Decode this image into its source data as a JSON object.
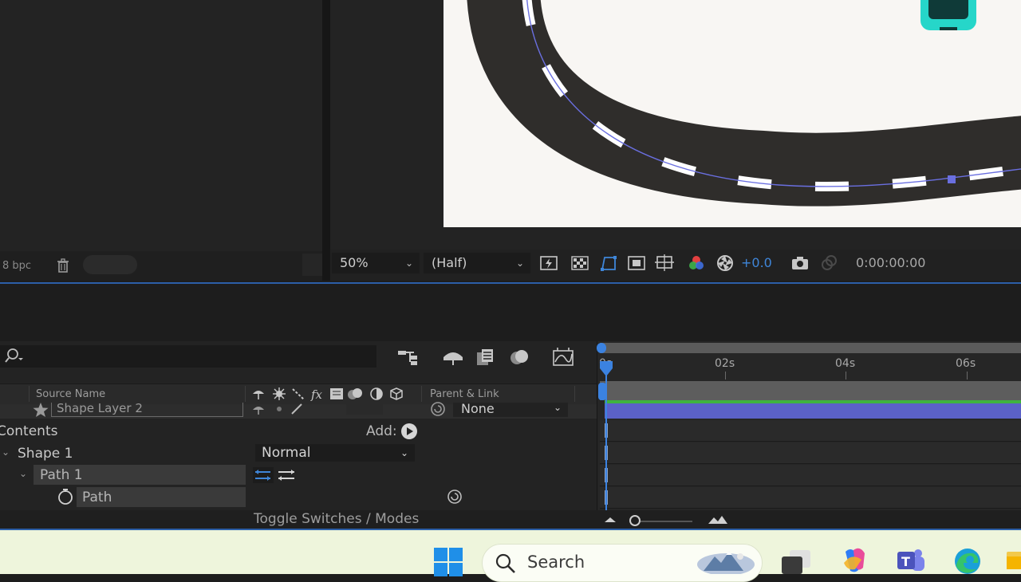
{
  "project_panel": {
    "bpc_label": "8 bpc",
    "delete_icon": "trash-icon"
  },
  "viewer": {
    "zoom": "50%",
    "resolution": "(Half)",
    "exposure": "+0.0",
    "timecode": "0:00:00:00",
    "icons": [
      "fast-preview-icon",
      "transparency-grid-icon",
      "mask-path-visibility-icon",
      "region-of-interest-icon",
      "grid-guides-icon",
      "color-channels-icon",
      "reset-exposure-icon",
      "snapshot-icon",
      "show-snapshot-icon"
    ],
    "accent": "#3f86d9",
    "canvas_color": "#f8f6f3"
  },
  "timeline": {
    "search_placeholder": "",
    "tool_icons": [
      "composition-flowchart-icon",
      "draft-3d-icon",
      "frame-blending-icon",
      "motion-blur-icon",
      "graph-editor-icon"
    ],
    "columns": {
      "source_name": "Source Name",
      "parent_link": "Parent & Link"
    },
    "switch_icons": [
      "shy-icon",
      "collapse-icon",
      "quality-icon",
      "effects-icon",
      "frame-blend-icon",
      "motion-blur-icon",
      "adjustment-layer-icon",
      "3d-layer-icon"
    ],
    "layer": {
      "name": "Shape Layer 2",
      "parent": "None"
    },
    "contents_label": "Contents",
    "add_label": "Add:",
    "shape_label": "Shape 1",
    "blend_mode": "Normal",
    "path_group_label": "Path 1",
    "path_label": "Path",
    "toggle_label": "Toggle Switches / Modes",
    "ruler": [
      "0s",
      "02s",
      "04s",
      "06s"
    ],
    "colors": {
      "layer_bar": "#5b61c7",
      "green_bar": "#3fb33f",
      "playhead": "#3b82e0"
    }
  },
  "taskbar": {
    "search_label": "Search",
    "icons": [
      "windows-start-icon",
      "search-icon",
      "widgets-icon",
      "task-view-icon",
      "copilot-icon",
      "teams-icon",
      "edge-icon",
      "file-explorer-icon"
    ],
    "background": "#eef5dc"
  }
}
